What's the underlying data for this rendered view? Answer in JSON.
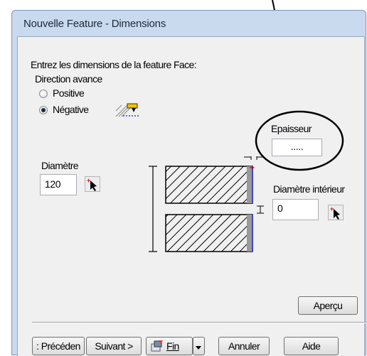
{
  "window": {
    "title": "Nouvelle Feature - Dimensions"
  },
  "form": {
    "prompt": "Entrez les dimensions de la feature Face:",
    "direction_label": "Direction avance",
    "options": [
      {
        "label": "Positive",
        "selected": false
      },
      {
        "label": "Négative",
        "selected": true
      }
    ]
  },
  "epaisseur": {
    "label": "Epaisseur",
    "value": "....."
  },
  "diametre": {
    "label": "Diamètre",
    "value": "120"
  },
  "diametre_interieur": {
    "label": "Diamètre intérieur",
    "value": "0"
  },
  "buttons": {
    "apercu": "Aperçu",
    "precedent": ": Précéden",
    "suivant": "Suivant >",
    "fin": "Fin",
    "annuler": "Annuler",
    "aide": "Aide"
  },
  "icons": [
    "direction-icon",
    "pick-point-icon",
    "fin-icon",
    "dropdown-arrow-icon"
  ],
  "colors": {
    "title_bar": "#c9d9ee",
    "client": "#f0f0f0",
    "annotation": "#000000",
    "marker_red": "#e00000",
    "marker_blue": "#2233cc"
  }
}
